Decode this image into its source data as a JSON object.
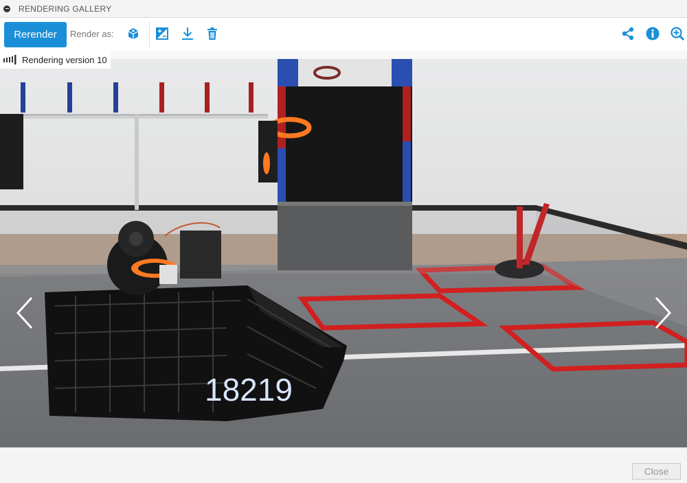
{
  "window": {
    "title": "RENDERING GALLERY"
  },
  "toolbar": {
    "rerender_label": "Rerender",
    "render_as_label": "Render as:",
    "icons_left": [
      "render-mode-icon",
      "adjust-image-icon",
      "download-icon",
      "delete-icon"
    ],
    "icons_right": [
      "share-icon",
      "info-icon",
      "zoom-in-icon"
    ],
    "accent_color": "#1a8fd8"
  },
  "version_badge": {
    "label": "Rendering version 10"
  },
  "image": {
    "robot_number": "18219"
  },
  "footer": {
    "close_label": "Close"
  }
}
